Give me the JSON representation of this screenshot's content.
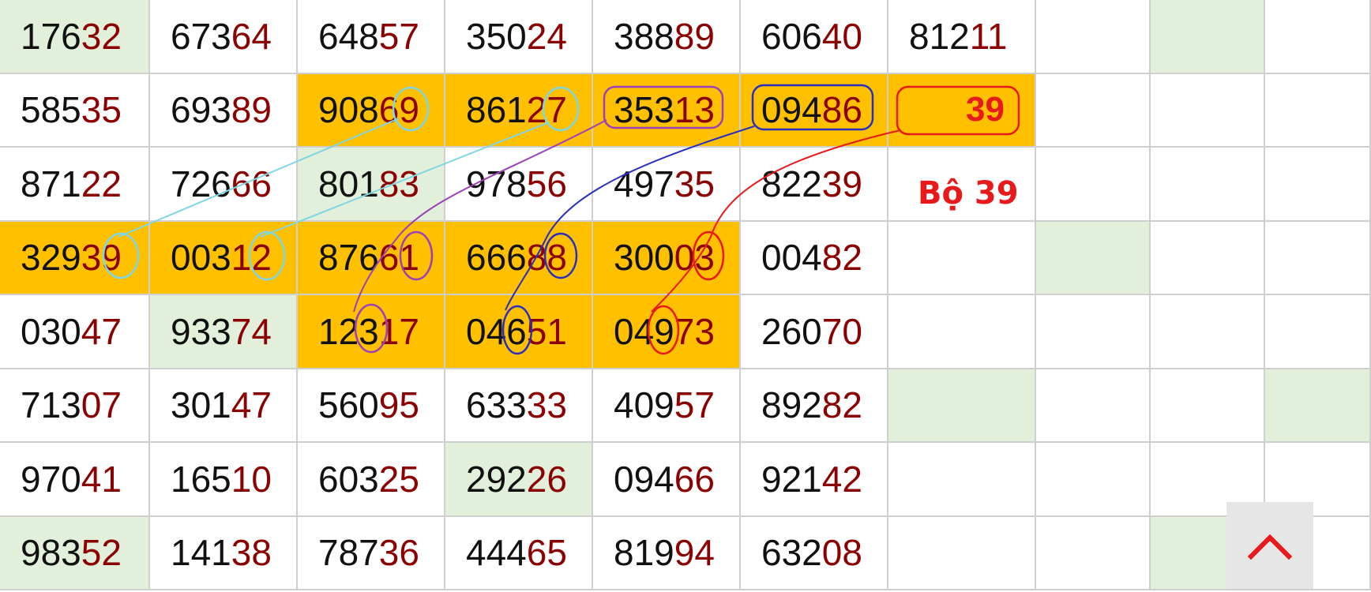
{
  "colors": {
    "highlight_yellow": "#ffc000",
    "highlight_green": "#e2efda",
    "grid_line": "#cfcfcf",
    "tail_digits": "#8b0000",
    "accent_red": "#e8191b",
    "cyan_link": "#7fd7e6",
    "purple_link": "#9b40b8",
    "blue_link": "#2a2fbf",
    "red_link": "#e8191b"
  },
  "grid": {
    "rows": [
      {
        "cells": [
          {
            "lead": "176",
            "tail": "32",
            "bg": "green"
          },
          {
            "lead": "673",
            "tail": "64",
            "bg": "none"
          },
          {
            "lead": "648",
            "tail": "57",
            "bg": "none"
          },
          {
            "lead": "350",
            "tail": "24",
            "bg": "none"
          },
          {
            "lead": "388",
            "tail": "89",
            "bg": "none"
          },
          {
            "lead": "606",
            "tail": "40",
            "bg": "none"
          },
          {
            "lead": "812",
            "tail": "11",
            "bg": "none"
          },
          {
            "lead": "",
            "tail": "",
            "bg": "none"
          },
          {
            "lead": "",
            "tail": "",
            "bg": "green"
          },
          {
            "lead": "",
            "tail": "",
            "bg": "none"
          }
        ]
      },
      {
        "cells": [
          {
            "lead": "585",
            "tail": "35",
            "bg": "none"
          },
          {
            "lead": "693",
            "tail": "89",
            "bg": "none"
          },
          {
            "lead": "908",
            "tail": "69",
            "bg": "yellow"
          },
          {
            "lead": "861",
            "tail": "27",
            "bg": "yellow"
          },
          {
            "lead": "353",
            "tail": "13",
            "bg": "yellow"
          },
          {
            "lead": "094",
            "tail": "86",
            "bg": "yellow"
          },
          {
            "lead": "",
            "tail": "",
            "highlight": "39",
            "bg": "yellow"
          },
          {
            "lead": "",
            "tail": "",
            "bg": "none"
          },
          {
            "lead": "",
            "tail": "",
            "bg": "none"
          },
          {
            "lead": "",
            "tail": "",
            "bg": "none"
          }
        ]
      },
      {
        "cells": [
          {
            "lead": "871",
            "tail": "22",
            "bg": "none"
          },
          {
            "lead": "726",
            "tail": "66",
            "bg": "none"
          },
          {
            "lead": "801",
            "tail": "83",
            "bg": "green"
          },
          {
            "lead": "978",
            "tail": "56",
            "bg": "none"
          },
          {
            "lead": "497",
            "tail": "35",
            "bg": "none"
          },
          {
            "lead": "822",
            "tail": "39",
            "bg": "none"
          },
          {
            "lead": "",
            "tail": "",
            "bg": "none"
          },
          {
            "lead": "",
            "tail": "",
            "bg": "none"
          },
          {
            "lead": "",
            "tail": "",
            "bg": "none"
          },
          {
            "lead": "",
            "tail": "",
            "bg": "none"
          }
        ]
      },
      {
        "cells": [
          {
            "lead": "329",
            "tail": "39",
            "bg": "yellow"
          },
          {
            "lead": "003",
            "tail": "12",
            "bg": "yellow"
          },
          {
            "lead": "876",
            "tail": "61",
            "bg": "yellow"
          },
          {
            "lead": "666",
            "tail": "88",
            "bg": "yellow"
          },
          {
            "lead": "300",
            "tail": "03",
            "bg": "yellow"
          },
          {
            "lead": "004",
            "tail": "82",
            "bg": "none"
          },
          {
            "lead": "",
            "tail": "",
            "bg": "none"
          },
          {
            "lead": "",
            "tail": "",
            "bg": "green"
          },
          {
            "lead": "",
            "tail": "",
            "bg": "none"
          },
          {
            "lead": "",
            "tail": "",
            "bg": "none"
          }
        ]
      },
      {
        "cells": [
          {
            "lead": "030",
            "tail": "47",
            "bg": "none"
          },
          {
            "lead": "933",
            "tail": "74",
            "bg": "green"
          },
          {
            "lead": "123",
            "tail": "17",
            "bg": "yellow"
          },
          {
            "lead": "046",
            "tail": "51",
            "bg": "yellow"
          },
          {
            "lead": "049",
            "tail": "73",
            "bg": "yellow"
          },
          {
            "lead": "260",
            "tail": "70",
            "bg": "none"
          },
          {
            "lead": "",
            "tail": "",
            "bg": "none"
          },
          {
            "lead": "",
            "tail": "",
            "bg": "none"
          },
          {
            "lead": "",
            "tail": "",
            "bg": "none"
          },
          {
            "lead": "",
            "tail": "",
            "bg": "none"
          }
        ]
      },
      {
        "cells": [
          {
            "lead": "713",
            "tail": "07",
            "bg": "none"
          },
          {
            "lead": "301",
            "tail": "47",
            "bg": "none"
          },
          {
            "lead": "560",
            "tail": "95",
            "bg": "none"
          },
          {
            "lead": "633",
            "tail": "33",
            "bg": "none"
          },
          {
            "lead": "409",
            "tail": "57",
            "bg": "none"
          },
          {
            "lead": "892",
            "tail": "82",
            "bg": "none"
          },
          {
            "lead": "",
            "tail": "",
            "bg": "green"
          },
          {
            "lead": "",
            "tail": "",
            "bg": "none"
          },
          {
            "lead": "",
            "tail": "",
            "bg": "none"
          },
          {
            "lead": "",
            "tail": "",
            "bg": "green"
          }
        ]
      },
      {
        "cells": [
          {
            "lead": "970",
            "tail": "41",
            "bg": "none"
          },
          {
            "lead": "165",
            "tail": "10",
            "bg": "none"
          },
          {
            "lead": "603",
            "tail": "25",
            "bg": "none"
          },
          {
            "lead": "292",
            "tail": "26",
            "bg": "green"
          },
          {
            "lead": "094",
            "tail": "66",
            "bg": "none"
          },
          {
            "lead": "921",
            "tail": "42",
            "bg": "none"
          },
          {
            "lead": "",
            "tail": "",
            "bg": "none"
          },
          {
            "lead": "",
            "tail": "",
            "bg": "none"
          },
          {
            "lead": "",
            "tail": "",
            "bg": "none"
          },
          {
            "lead": "",
            "tail": "",
            "bg": "none"
          }
        ]
      },
      {
        "cells": [
          {
            "lead": "983",
            "tail": "52",
            "bg": "green"
          },
          {
            "lead": "141",
            "tail": "38",
            "bg": "none"
          },
          {
            "lead": "787",
            "tail": "36",
            "bg": "none"
          },
          {
            "lead": "444",
            "tail": "65",
            "bg": "none"
          },
          {
            "lead": "819",
            "tail": "94",
            "bg": "none"
          },
          {
            "lead": "632",
            "tail": "08",
            "bg": "none"
          },
          {
            "lead": "",
            "tail": "",
            "bg": "none"
          },
          {
            "lead": "",
            "tail": "",
            "bg": "none"
          },
          {
            "lead": "",
            "tail": "",
            "bg": "green"
          },
          {
            "lead": "",
            "tail": "",
            "bg": "none"
          }
        ]
      }
    ]
  },
  "annotation": {
    "label": "Bộ 39"
  },
  "icons": {
    "scroll_top": "chevron-up-icon"
  }
}
